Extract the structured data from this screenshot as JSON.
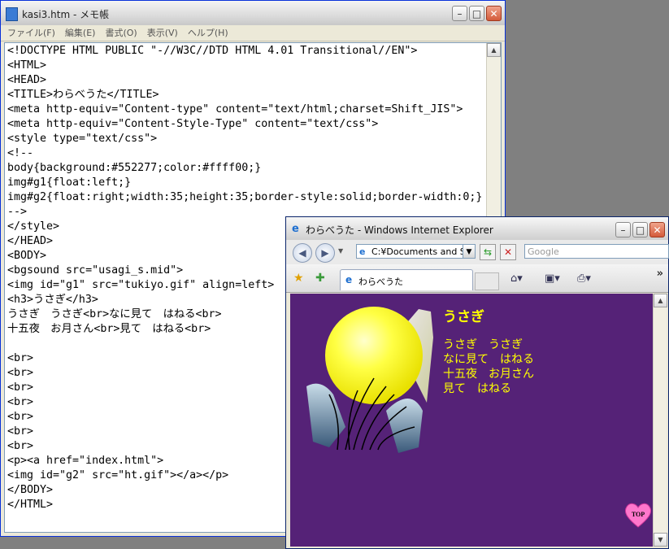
{
  "notepad": {
    "title": "kasi3.htm - メモ帳",
    "menu": [
      "ファイル(F)",
      "編集(E)",
      "書式(O)",
      "表示(V)",
      "ヘルプ(H)"
    ],
    "lines": [
      "<!DOCTYPE HTML PUBLIC \"-//W3C//DTD HTML 4.01 Transitional//EN\">",
      "<HTML>",
      "<HEAD>",
      "<TITLE>わらべうた</TITLE>",
      "<meta http-equiv=\"Content-type\" content=\"text/html;charset=Shift_JIS\">",
      "<meta http-equiv=\"Content-Style-Type\" content=\"text/css\">",
      "<style type=\"text/css\">",
      "<!--",
      "body{background:#552277;color:#ffff00;}",
      "img#g1{float:left;}",
      "img#g2{float:right;width:35;height:35;border-style:solid;border-width:0;}",
      "-->",
      "</style>",
      "</HEAD>",
      "<BODY>",
      "<bgsound src=\"usagi_s.mid\">",
      "<img id=\"g1\" src=\"tukiyo.gif\" align=left>",
      "<h3>うさぎ</h3>",
      "うさぎ　うさぎ<br>なに見て　はねる<br>",
      "十五夜　お月さん<br>見て　はねる<br>",
      "",
      "<br>",
      "<br>",
      "<br>",
      "<br>",
      "<br>",
      "<br>",
      "<br>",
      "<p><a href=\"index.html\">",
      "<img id=\"g2\" src=\"ht.gif\"></a></p>",
      "</BODY>",
      "</HTML>"
    ]
  },
  "browser": {
    "title": "わらべうた - Windows Internet Explorer",
    "address": "C:¥Documents and S",
    "search_placeholder": "Google",
    "tab_label": "わらべうた",
    "page": {
      "heading": "うさぎ",
      "verse": [
        "うさぎ　うさぎ",
        "なに見て　はねる",
        "十五夜　お月さん",
        "見て　はねる"
      ],
      "top_link": "TOP"
    }
  },
  "colors": {
    "page_bg": "#552277",
    "page_text": "#ffff00",
    "moon": "#ffff44"
  }
}
